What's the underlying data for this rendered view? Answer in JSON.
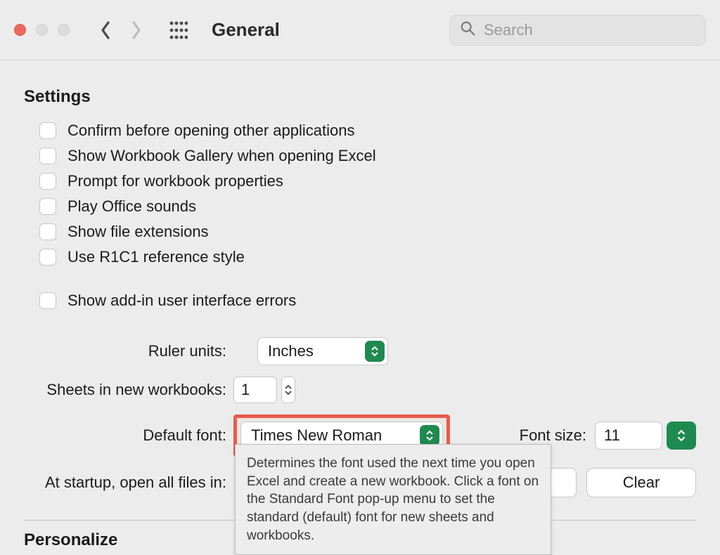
{
  "toolbar": {
    "title": "General",
    "search_placeholder": "Search"
  },
  "sections": {
    "settings_heading": "Settings",
    "personalize_heading": "Personalize"
  },
  "options": {
    "confirm_apps": "Confirm before opening other applications",
    "show_gallery": "Show Workbook Gallery when opening Excel",
    "prompt_props": "Prompt for workbook properties",
    "play_sounds": "Play Office sounds",
    "show_ext": "Show file extensions",
    "r1c1": "Use R1C1 reference style",
    "addin_errors": "Show add-in user interface errors"
  },
  "form": {
    "ruler_label": "Ruler units:",
    "ruler_value": "Inches",
    "sheets_label": "Sheets in new workbooks:",
    "sheets_value": "1",
    "default_font_label": "Default font:",
    "default_font_value": "Times New Roman",
    "font_size_label": "Font size:",
    "font_size_value": "11",
    "startup_label": "At startup, open all files in:",
    "clear_label": "Clear"
  },
  "tooltip": {
    "text": "Determines the font used the next time you open Excel and create a new workbook. Click a font on the Standard Font pop-up menu to set the standard (default) font for new sheets and workbooks."
  }
}
